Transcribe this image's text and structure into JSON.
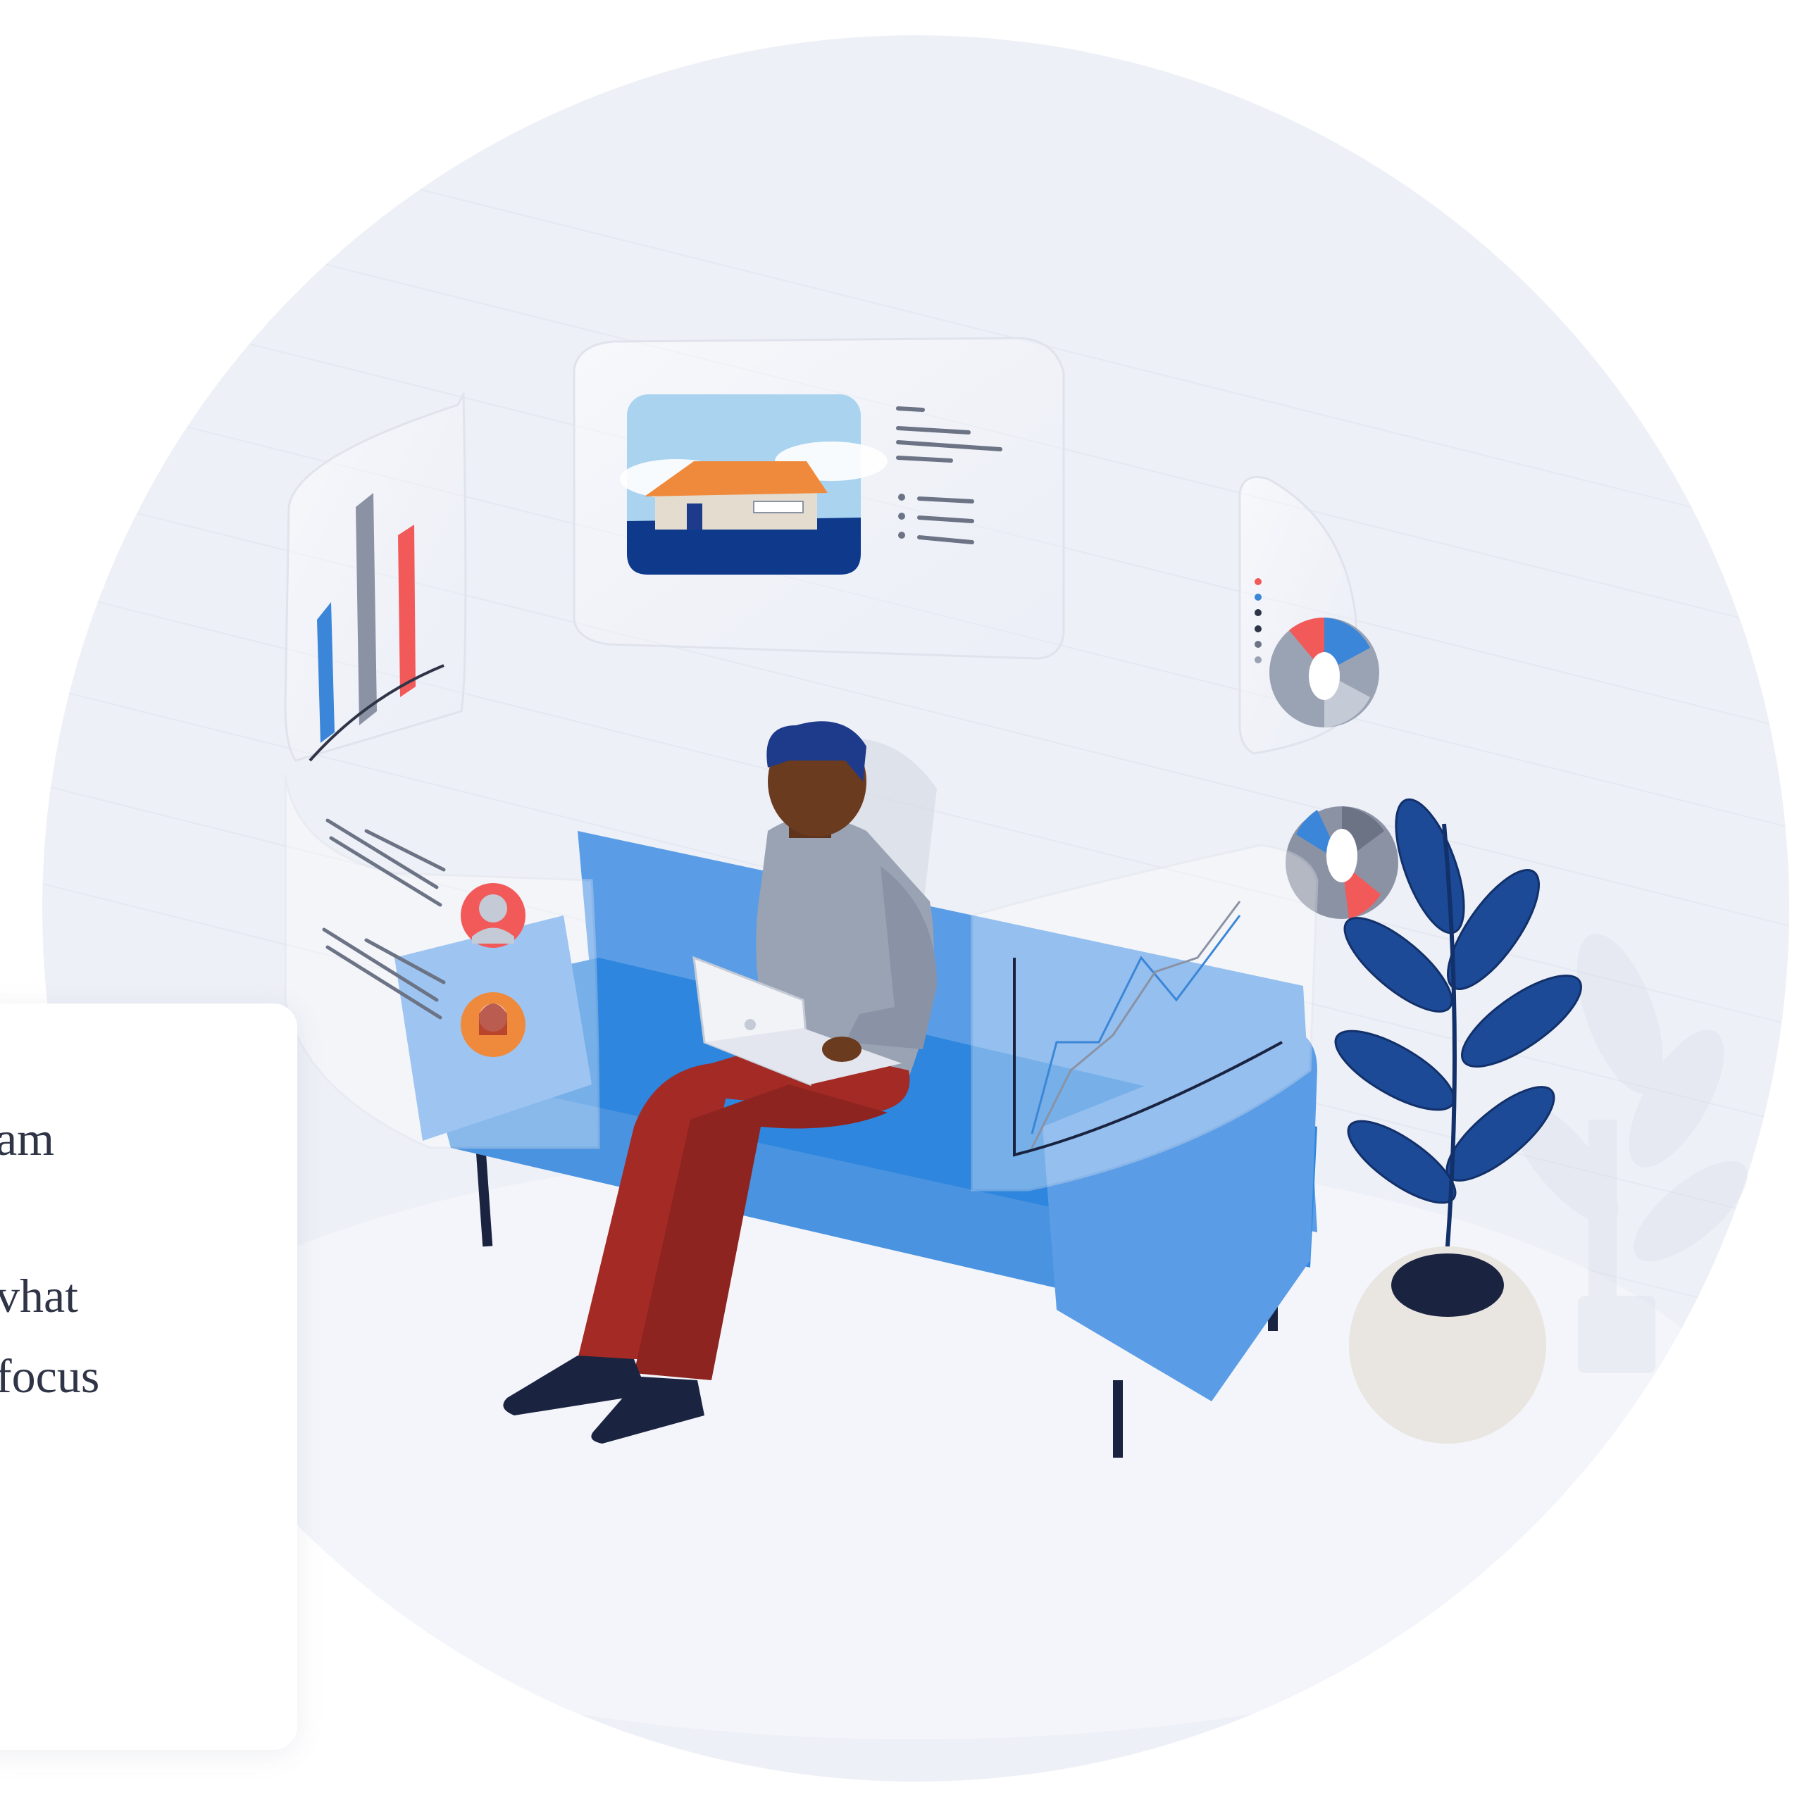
{
  "card": {
    "lines": [
      "am",
      "vhat",
      "focus"
    ]
  },
  "illustration": {
    "subject": "person-on-sofa-with-laptop",
    "colors": {
      "backdrop": "#eef0f7",
      "sofa": "#4f98e3",
      "sofa_seat": "#2e86de",
      "shirt": "#9aa3b3",
      "pants": "#a32a25",
      "hair": "#1e3a8a",
      "skin": "#6b3b20",
      "plant_leaf": "#1c4a96",
      "pot": "#e9e6e1",
      "accent_red": "#f25a5a",
      "accent_blue": "#3b86d8",
      "house_roof": "#ef8a3c",
      "sky": "#a9d3ef",
      "water": "#0f3a8c"
    },
    "icons": [
      "bar-chart-icon",
      "house-photo-icon",
      "donut-chart-icon",
      "line-chart-icon",
      "avatar-icon"
    ]
  }
}
